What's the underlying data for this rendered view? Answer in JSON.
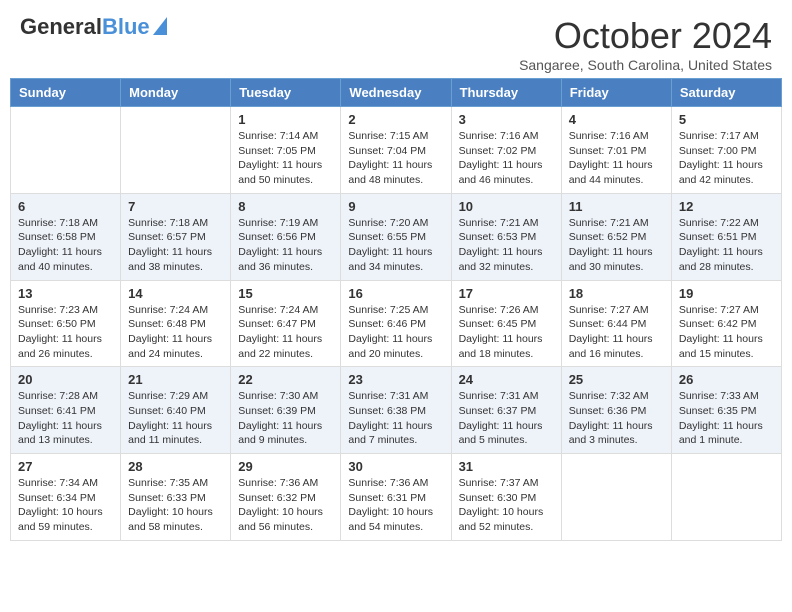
{
  "header": {
    "logo_line1": "General",
    "logo_line2": "Blue",
    "main_title": "October 2024",
    "subtitle": "Sangaree, South Carolina, United States"
  },
  "calendar": {
    "days_of_week": [
      "Sunday",
      "Monday",
      "Tuesday",
      "Wednesday",
      "Thursday",
      "Friday",
      "Saturday"
    ],
    "weeks": [
      [
        {
          "day": "",
          "info": ""
        },
        {
          "day": "",
          "info": ""
        },
        {
          "day": "1",
          "info": "Sunrise: 7:14 AM\nSunset: 7:05 PM\nDaylight: 11 hours and 50 minutes."
        },
        {
          "day": "2",
          "info": "Sunrise: 7:15 AM\nSunset: 7:04 PM\nDaylight: 11 hours and 48 minutes."
        },
        {
          "day": "3",
          "info": "Sunrise: 7:16 AM\nSunset: 7:02 PM\nDaylight: 11 hours and 46 minutes."
        },
        {
          "day": "4",
          "info": "Sunrise: 7:16 AM\nSunset: 7:01 PM\nDaylight: 11 hours and 44 minutes."
        },
        {
          "day": "5",
          "info": "Sunrise: 7:17 AM\nSunset: 7:00 PM\nDaylight: 11 hours and 42 minutes."
        }
      ],
      [
        {
          "day": "6",
          "info": "Sunrise: 7:18 AM\nSunset: 6:58 PM\nDaylight: 11 hours and 40 minutes."
        },
        {
          "day": "7",
          "info": "Sunrise: 7:18 AM\nSunset: 6:57 PM\nDaylight: 11 hours and 38 minutes."
        },
        {
          "day": "8",
          "info": "Sunrise: 7:19 AM\nSunset: 6:56 PM\nDaylight: 11 hours and 36 minutes."
        },
        {
          "day": "9",
          "info": "Sunrise: 7:20 AM\nSunset: 6:55 PM\nDaylight: 11 hours and 34 minutes."
        },
        {
          "day": "10",
          "info": "Sunrise: 7:21 AM\nSunset: 6:53 PM\nDaylight: 11 hours and 32 minutes."
        },
        {
          "day": "11",
          "info": "Sunrise: 7:21 AM\nSunset: 6:52 PM\nDaylight: 11 hours and 30 minutes."
        },
        {
          "day": "12",
          "info": "Sunrise: 7:22 AM\nSunset: 6:51 PM\nDaylight: 11 hours and 28 minutes."
        }
      ],
      [
        {
          "day": "13",
          "info": "Sunrise: 7:23 AM\nSunset: 6:50 PM\nDaylight: 11 hours and 26 minutes."
        },
        {
          "day": "14",
          "info": "Sunrise: 7:24 AM\nSunset: 6:48 PM\nDaylight: 11 hours and 24 minutes."
        },
        {
          "day": "15",
          "info": "Sunrise: 7:24 AM\nSunset: 6:47 PM\nDaylight: 11 hours and 22 minutes."
        },
        {
          "day": "16",
          "info": "Sunrise: 7:25 AM\nSunset: 6:46 PM\nDaylight: 11 hours and 20 minutes."
        },
        {
          "day": "17",
          "info": "Sunrise: 7:26 AM\nSunset: 6:45 PM\nDaylight: 11 hours and 18 minutes."
        },
        {
          "day": "18",
          "info": "Sunrise: 7:27 AM\nSunset: 6:44 PM\nDaylight: 11 hours and 16 minutes."
        },
        {
          "day": "19",
          "info": "Sunrise: 7:27 AM\nSunset: 6:42 PM\nDaylight: 11 hours and 15 minutes."
        }
      ],
      [
        {
          "day": "20",
          "info": "Sunrise: 7:28 AM\nSunset: 6:41 PM\nDaylight: 11 hours and 13 minutes."
        },
        {
          "day": "21",
          "info": "Sunrise: 7:29 AM\nSunset: 6:40 PM\nDaylight: 11 hours and 11 minutes."
        },
        {
          "day": "22",
          "info": "Sunrise: 7:30 AM\nSunset: 6:39 PM\nDaylight: 11 hours and 9 minutes."
        },
        {
          "day": "23",
          "info": "Sunrise: 7:31 AM\nSunset: 6:38 PM\nDaylight: 11 hours and 7 minutes."
        },
        {
          "day": "24",
          "info": "Sunrise: 7:31 AM\nSunset: 6:37 PM\nDaylight: 11 hours and 5 minutes."
        },
        {
          "day": "25",
          "info": "Sunrise: 7:32 AM\nSunset: 6:36 PM\nDaylight: 11 hours and 3 minutes."
        },
        {
          "day": "26",
          "info": "Sunrise: 7:33 AM\nSunset: 6:35 PM\nDaylight: 11 hours and 1 minute."
        }
      ],
      [
        {
          "day": "27",
          "info": "Sunrise: 7:34 AM\nSunset: 6:34 PM\nDaylight: 10 hours and 59 minutes."
        },
        {
          "day": "28",
          "info": "Sunrise: 7:35 AM\nSunset: 6:33 PM\nDaylight: 10 hours and 58 minutes."
        },
        {
          "day": "29",
          "info": "Sunrise: 7:36 AM\nSunset: 6:32 PM\nDaylight: 10 hours and 56 minutes."
        },
        {
          "day": "30",
          "info": "Sunrise: 7:36 AM\nSunset: 6:31 PM\nDaylight: 10 hours and 54 minutes."
        },
        {
          "day": "31",
          "info": "Sunrise: 7:37 AM\nSunset: 6:30 PM\nDaylight: 10 hours and 52 minutes."
        },
        {
          "day": "",
          "info": ""
        },
        {
          "day": "",
          "info": ""
        }
      ]
    ]
  }
}
